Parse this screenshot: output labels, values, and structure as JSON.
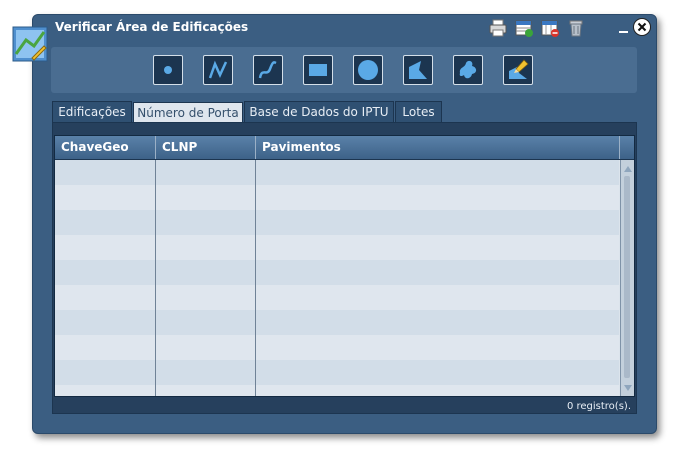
{
  "window": {
    "title": "Verificar Área de Edificações",
    "app_icon": "map-edit-icon",
    "title_tools": [
      "print-icon",
      "export-grid-icon",
      "calendar-delete-icon",
      "trash-icon"
    ],
    "minimize_icon": "minimize-icon",
    "close_icon": "close-icon"
  },
  "draw_tools": [
    {
      "name": "point-tool",
      "icon": "point-icon"
    },
    {
      "name": "polyline-tool",
      "icon": "polyline-icon"
    },
    {
      "name": "freehand-line-tool",
      "icon": "freehand-line-icon"
    },
    {
      "name": "rectangle-tool",
      "icon": "rectangle-icon"
    },
    {
      "name": "circle-tool",
      "icon": "circle-icon"
    },
    {
      "name": "polygon-tool",
      "icon": "polygon-icon"
    },
    {
      "name": "freehand-polygon-tool",
      "icon": "freehand-polygon-icon"
    },
    {
      "name": "edit-tool",
      "icon": "pencil-icon"
    }
  ],
  "tabs": [
    {
      "label": "Edificações",
      "active": false
    },
    {
      "label": "Número de Porta",
      "active": true
    },
    {
      "label": "Base de Dados do IPTU",
      "active": false
    },
    {
      "label": "Lotes",
      "active": false
    }
  ],
  "grid": {
    "columns": [
      "ChaveGeo",
      "CLNP",
      "Pavimentos"
    ],
    "rows": []
  },
  "status": {
    "record_count_text": "0 registro(s)."
  },
  "colors": {
    "window_bg": "#3b5e82",
    "tool_button_bg": "#1c3550",
    "tool_icon": "#5aa9e6",
    "row_alt_a": "#d2dde8",
    "row_alt_b": "#dfe6ee"
  }
}
